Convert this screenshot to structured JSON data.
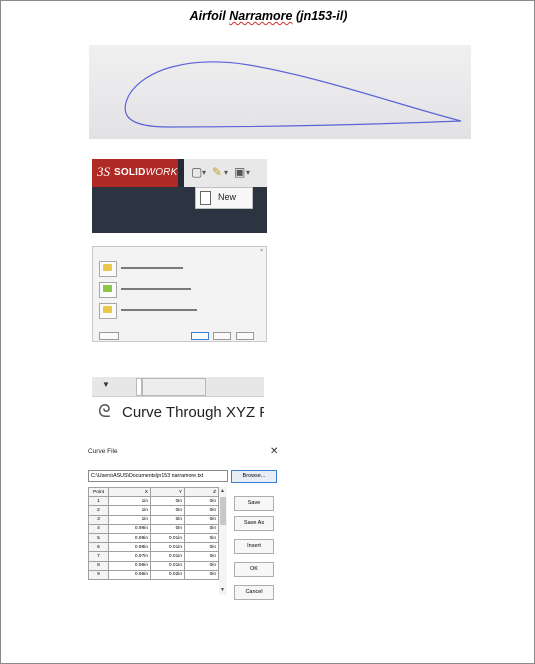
{
  "document": {
    "title_prefix": "Airfoil",
    "title_underlined": "Narramore",
    "title_suffix": "(jn153-il)"
  },
  "solidworks": {
    "logo_mark": "3S",
    "brand_bold": "SOLID",
    "brand_light": "WORKS",
    "menu_new_label": "New"
  },
  "curve_through_xyz": {
    "label": "Curve Through XYZ Poir"
  },
  "curve_file_dialog": {
    "title": "Curve File",
    "path_value": "C:\\Users\\ASUS\\Documents\\jn153 narramore.txt",
    "browse_label": "Browse...",
    "columns": [
      "Point",
      "X",
      "Y",
      "Z"
    ],
    "rows": [
      [
        "1",
        "1in",
        "0in",
        "0in"
      ],
      [
        "2",
        "1in",
        "0in",
        "0in"
      ],
      [
        "3",
        "1in",
        "0in",
        "0in"
      ],
      [
        "4",
        "0.99in",
        "0in",
        "0in"
      ],
      [
        "5",
        "0.99in",
        "0.01in",
        "0in"
      ],
      [
        "6",
        "0.98in",
        "0.01in",
        "0in"
      ],
      [
        "7",
        "0.97in",
        "0.01in",
        "0in"
      ],
      [
        "8",
        "0.96in",
        "0.01in",
        "0in"
      ],
      [
        "9",
        "0.95in",
        "0.02in",
        "0in"
      ]
    ],
    "buttons": {
      "save": "Save",
      "save_as": "Save As",
      "insert": "Insert",
      "ok": "OK",
      "cancel": "Cancel"
    }
  },
  "colors": {
    "airfoil_stroke": "#5a64d6",
    "solidworks_red": "#b02a25",
    "browse_border": "#3a7fd5"
  }
}
